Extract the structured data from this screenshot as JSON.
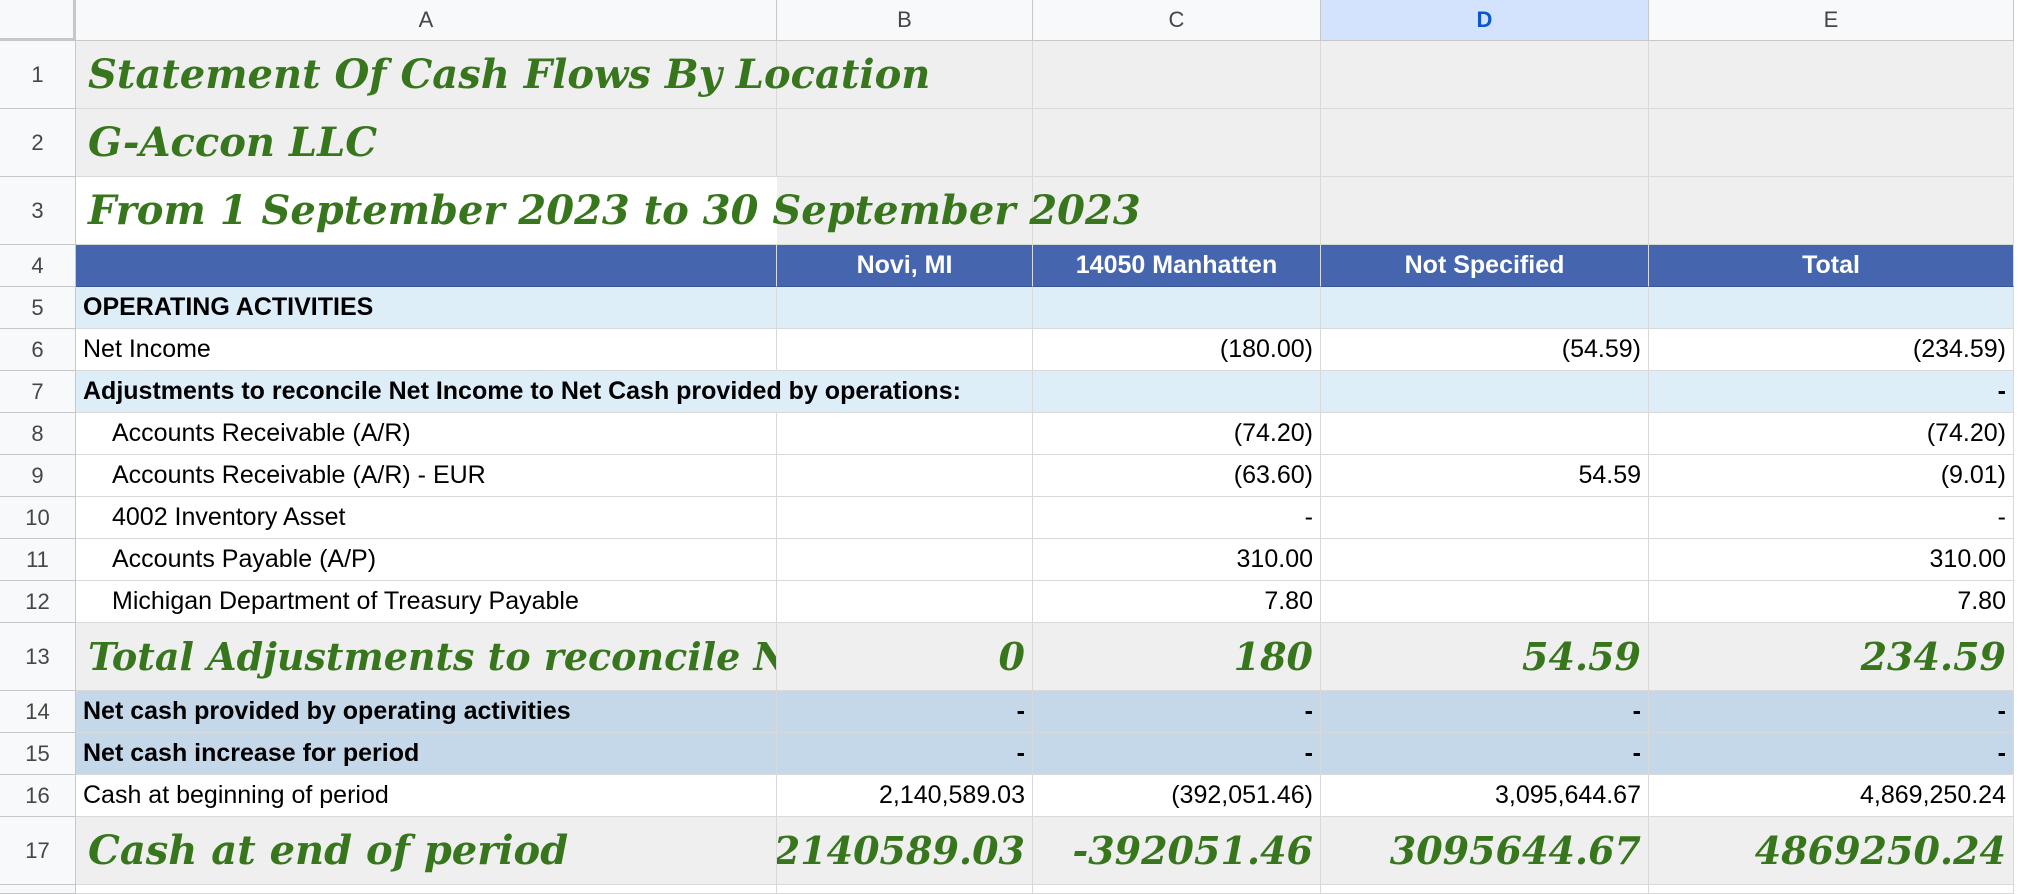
{
  "columns": [
    "A",
    "B",
    "C",
    "D",
    "E"
  ],
  "selected_column": "D",
  "rows": [
    "1",
    "2",
    "3",
    "4",
    "5",
    "6",
    "7",
    "8",
    "9",
    "10",
    "11",
    "12",
    "13",
    "14",
    "15",
    "16",
    "17"
  ],
  "report": {
    "title": "Statement Of Cash Flows By Location",
    "company": "G-Accon LLC",
    "period": "From 1 September 2023 to 30 September 2023"
  },
  "header": {
    "b": "Novi, MI",
    "c": "14050 Manhatten",
    "d": "Not Specified",
    "e": "Total"
  },
  "operating": {
    "label": "OPERATING ACTIVITIES"
  },
  "net_income": {
    "label": "Net Income",
    "b": "",
    "c": "(180.00)",
    "d": "(54.59)",
    "e": "(234.59)"
  },
  "adjustments_header": {
    "label": "Adjustments to reconcile Net Income to Net Cash provided by operations:",
    "e": "-"
  },
  "items": [
    {
      "label": "Accounts Receivable (A/R)",
      "b": "",
      "c": "(74.20)",
      "d": "",
      "e": "(74.20)"
    },
    {
      "label": "Accounts Receivable (A/R) - EUR",
      "b": "",
      "c": "(63.60)",
      "d": "54.59",
      "e": "(9.01)"
    },
    {
      "label": "4002 Inventory Asset",
      "b": "",
      "c": "-",
      "d": "",
      "e": "-"
    },
    {
      "label": "Accounts Payable (A/P)",
      "b": "",
      "c": "310.00",
      "d": "",
      "e": "310.00"
    },
    {
      "label": "Michigan Department of Treasury Payable",
      "b": "",
      "c": "7.80",
      "d": "",
      "e": "7.80"
    }
  ],
  "total_adjustments": {
    "label": "Total Adjustments to reconcile Net Income",
    "b": "0",
    "c": "180",
    "d": "54.59",
    "e": "234.59"
  },
  "net_cash_operating": {
    "label": "Net cash provided by operating activities",
    "b": "-",
    "c": "-",
    "d": "-",
    "e": "-"
  },
  "net_cash_increase": {
    "label": "Net cash increase for period",
    "b": "-",
    "c": "-",
    "d": "-",
    "e": "-"
  },
  "cash_begin": {
    "label": "Cash at beginning of period",
    "b": "2,140,589.03",
    "c": "(392,051.46)",
    "d": "3,095,644.67",
    "e": "4,869,250.24"
  },
  "cash_end": {
    "label": "Cash at end of period",
    "b": "2140589.03",
    "c": "-392051.46",
    "d": "3095644.67",
    "e": "4869250.24"
  },
  "colors": {
    "header_bar": "#4565ae",
    "section_blue": "#ddeef9",
    "subtotal_gray": "#efefef",
    "summary_steel": "#c5d8ea",
    "script_green": "#38761d",
    "selected_header": "#d3e3fd"
  }
}
